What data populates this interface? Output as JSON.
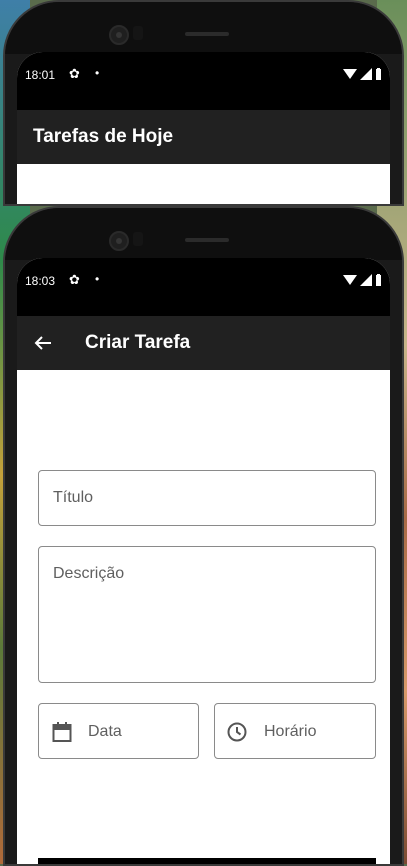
{
  "screen1": {
    "status": {
      "time": "18:01",
      "settings_icon": "gear-icon",
      "notif_dot": "•"
    },
    "appbar": {
      "title": "Tarefas de Hoje"
    }
  },
  "screen2": {
    "status": {
      "time": "18:03",
      "settings_icon": "gear-icon",
      "notif_dot": "•"
    },
    "appbar": {
      "title": "Criar Tarefa",
      "back_icon": "back-arrow-icon"
    },
    "form": {
      "title_placeholder": "Título",
      "description_placeholder": "Descrição",
      "date_label": "Data",
      "date_icon": "calendar-icon",
      "time_label": "Horário",
      "time_icon": "clock-icon"
    }
  },
  "colors": {
    "appbar_bg": "#212121",
    "statusbar_bg": "#000000",
    "field_border": "#8a8a8a",
    "placeholder": "#5f5f5f"
  }
}
